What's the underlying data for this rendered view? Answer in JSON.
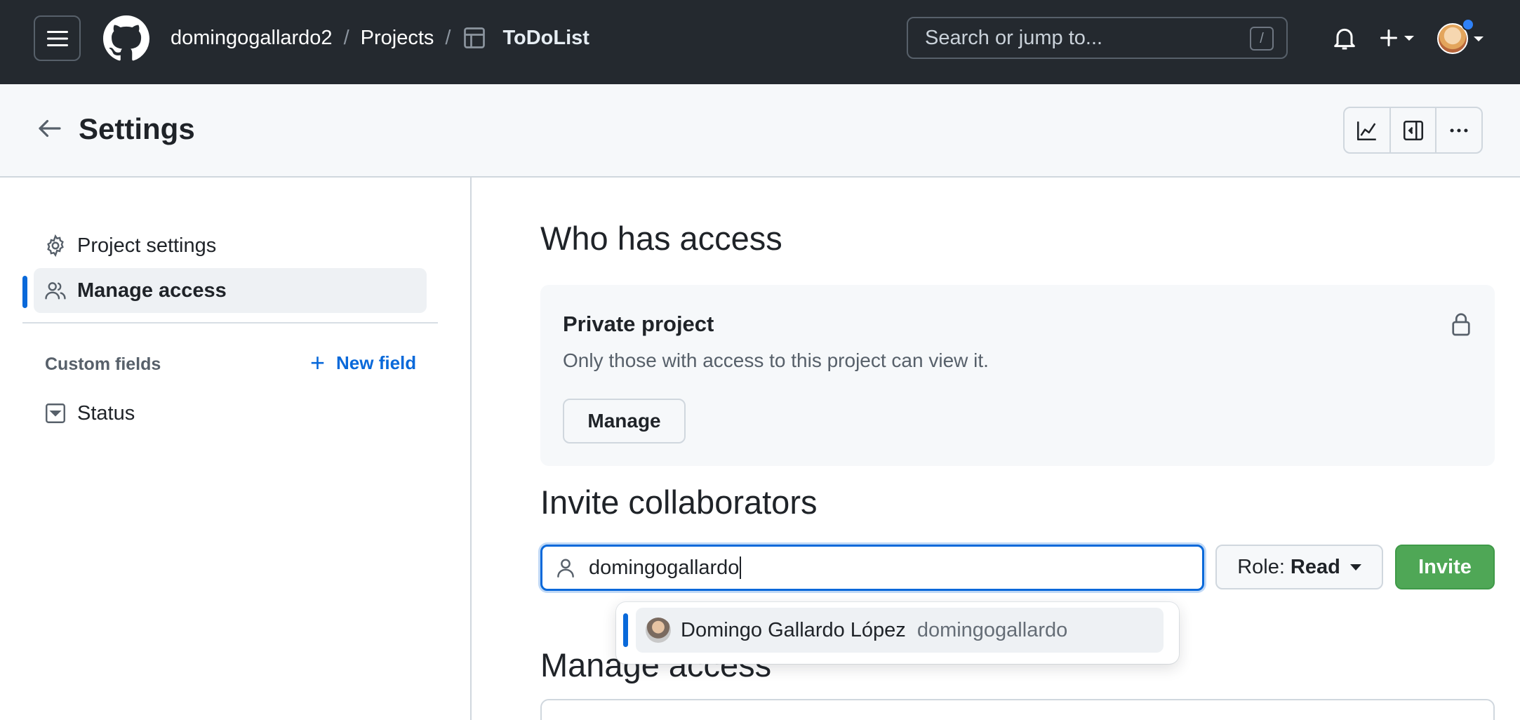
{
  "topbar": {
    "breadcrumbs": {
      "owner": "domingogallardo2",
      "section": "Projects",
      "project": "ToDoList",
      "separator": "/"
    },
    "search": {
      "placeholder": "Search or jump to...",
      "shortcut": "/"
    },
    "icons": [
      "hamburger-icon",
      "github-logo",
      "table-icon",
      "bell-icon",
      "plus-icon",
      "avatar"
    ],
    "notification_color": "#2f81f7"
  },
  "header": {
    "title": "Settings",
    "tools": [
      "insights-icon",
      "sidebar-collapse-icon",
      "kebab-icon"
    ]
  },
  "sidebar": {
    "items": [
      {
        "label": "Project settings",
        "icon": "gear-icon",
        "active": false
      },
      {
        "label": "Manage access",
        "icon": "people-icon",
        "active": true
      }
    ],
    "custom_fields": {
      "label": "Custom fields",
      "new_field": "New field",
      "items": [
        {
          "label": "Status",
          "icon": "single-select-icon"
        }
      ]
    }
  },
  "main": {
    "who_has_access": {
      "title": "Who has access",
      "private_title": "Private project",
      "private_desc": "Only those with access to this project can view it.",
      "manage_label": "Manage"
    },
    "invite": {
      "title": "Invite collaborators",
      "input_value": "domingogallardo",
      "role_prefix": "Role:",
      "role_value": "Read",
      "invite_label": "Invite",
      "suggestion": {
        "name": "Domingo Gallardo López",
        "login": "domingogallardo"
      }
    },
    "manage_access": {
      "title": "Manage access"
    }
  },
  "colors": {
    "accent": "#0969da",
    "invite_green": "#4fa756",
    "topbar": "#24292f"
  }
}
